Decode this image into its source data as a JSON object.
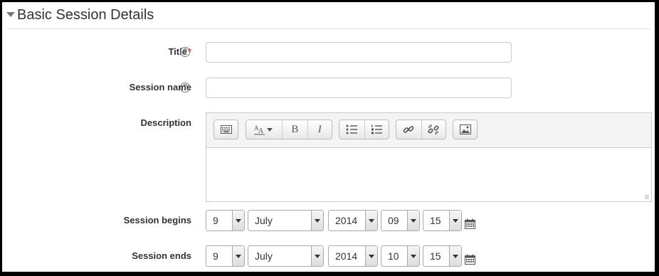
{
  "section": {
    "title": "Basic Session Details"
  },
  "fields": {
    "title": {
      "label": "Title",
      "required_mark": "*",
      "value": ""
    },
    "session_name": {
      "label": "Session name",
      "value": ""
    },
    "description": {
      "label": "Description",
      "value": ""
    },
    "session_begins": {
      "label": "Session begins",
      "day": "9",
      "month": "July",
      "year": "2014",
      "hour": "09",
      "minute": "15"
    },
    "session_ends": {
      "label": "Session ends",
      "day": "9",
      "month": "July",
      "year": "2014",
      "hour": "10",
      "minute": "15"
    }
  },
  "editor_toolbar": {
    "groups": [
      [
        "keyboard-toggle-icon"
      ],
      [
        "font-style-dropdown-icon",
        "bold-icon",
        "italic-icon"
      ],
      [
        "bullet-list-icon",
        "numbered-list-icon"
      ],
      [
        "link-icon",
        "unlink-icon"
      ],
      [
        "image-icon"
      ]
    ],
    "bold_glyph": "B",
    "italic_glyph": "I"
  },
  "help_glyph": "?",
  "colors": {
    "required": "#d9534f",
    "border": "#cccccc",
    "toolbar_bg": "#f4f4f4"
  }
}
